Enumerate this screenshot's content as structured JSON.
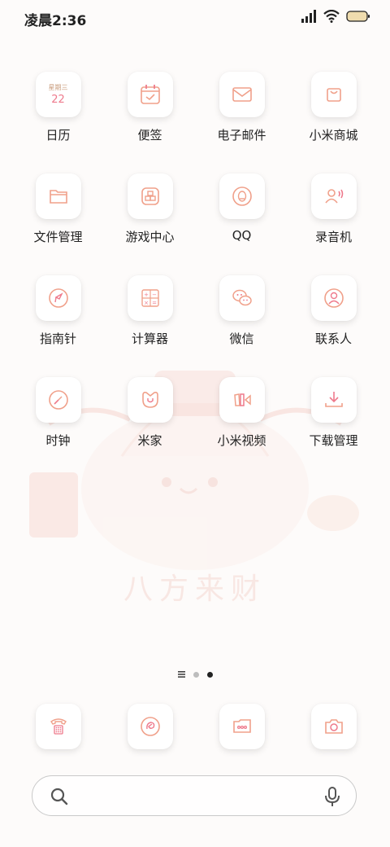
{
  "status_bar": {
    "time": "凌晨2:36"
  },
  "apps": [
    {
      "label": "日历",
      "icon": "calendar-icon"
    },
    {
      "label": "便签",
      "icon": "notes-icon"
    },
    {
      "label": "电子邮件",
      "icon": "email-icon"
    },
    {
      "label": "小米商城",
      "icon": "mi-store-icon"
    },
    {
      "label": "文件管理",
      "icon": "folder-icon"
    },
    {
      "label": "游戏中心",
      "icon": "game-center-icon"
    },
    {
      "label": "QQ",
      "icon": "qq-icon"
    },
    {
      "label": "录音机",
      "icon": "recorder-icon"
    },
    {
      "label": "指南针",
      "icon": "compass-icon"
    },
    {
      "label": "计算器",
      "icon": "calculator-icon"
    },
    {
      "label": "微信",
      "icon": "wechat-icon"
    },
    {
      "label": "联系人",
      "icon": "contacts-icon"
    },
    {
      "label": "时钟",
      "icon": "clock-icon"
    },
    {
      "label": "米家",
      "icon": "mijia-icon"
    },
    {
      "label": "小米视频",
      "icon": "mi-video-icon"
    },
    {
      "label": "下载管理",
      "icon": "download-icon"
    }
  ],
  "calendar": {
    "weekday": "星期三",
    "day": "22"
  },
  "wallpaper": {
    "text": "八方来财"
  },
  "page_indicator": {
    "pages": 3,
    "current": 3
  },
  "dock": [
    {
      "icon": "phone-icon"
    },
    {
      "icon": "browser-icon"
    },
    {
      "icon": "messages-icon"
    },
    {
      "icon": "camera-icon"
    }
  ],
  "colors": {
    "icon_line": "#f0a08a",
    "accent_pink": "#ee7a8c",
    "wallpaper_tint": "#f6d7d0"
  }
}
